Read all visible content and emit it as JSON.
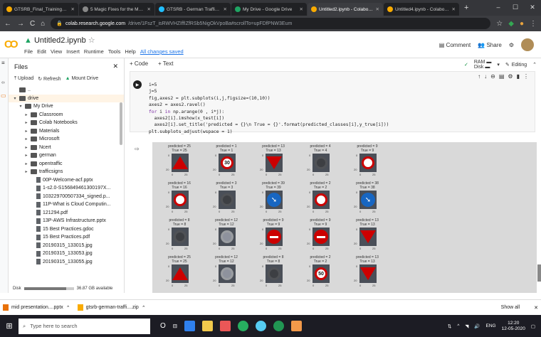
{
  "browser": {
    "tabs": [
      {
        "label": "GTSRB_Final_Training_Images",
        "color": "#f9ab00"
      },
      {
        "label": "5 Magic Fixes for the Most C",
        "color": "#888888"
      },
      {
        "label": "GTSRB - German Traffic Sign",
        "color": "#20beff"
      },
      {
        "label": "My Drive - Google Drive",
        "color": "#1fa463"
      },
      {
        "label": "Untitled2.ipynb - Colaborator",
        "color": "#f9ab00",
        "active": true
      },
      {
        "label": "Untitled4.ipynb - Colaborator",
        "color": "#f9ab00"
      }
    ],
    "url_host": "colab.research.google.com",
    "url_path": "/drive/1FszT_isRWVHZIffIZfRSb5NigOkVpoBa#scrollTo=upFDfPNW3Eum"
  },
  "colab": {
    "logo": "CO",
    "notebook_title": "Untitled2.ipynb",
    "menus": [
      "File",
      "Edit",
      "View",
      "Insert",
      "Runtime",
      "Tools",
      "Help"
    ],
    "saved_status": "All changes saved",
    "comment_label": "Comment",
    "share_label": "Share",
    "add_code": "+ Code",
    "add_text": "+ Text",
    "ram_label": "RAM",
    "disk_label": "Disk",
    "editing_label": "Editing"
  },
  "files_panel": {
    "title": "Files",
    "upload": "Upload",
    "refresh": "Refresh",
    "mount": "Mount Drive",
    "disk_text": "36.87 GB available",
    "disk_label": "Disk",
    "disk_used_fraction": 0.85,
    "items": [
      {
        "label": "..",
        "depth": 0,
        "kind": "folder"
      },
      {
        "label": "drive",
        "depth": 0,
        "kind": "folder",
        "caret": "▾"
      },
      {
        "label": "My Drive",
        "depth": 1,
        "kind": "folder",
        "caret": "▾"
      },
      {
        "label": "Classroom",
        "depth": 2,
        "kind": "folder",
        "caret": "▸"
      },
      {
        "label": "Colab Notebooks",
        "depth": 2,
        "kind": "folder",
        "caret": "▸"
      },
      {
        "label": "Materials",
        "depth": 2,
        "kind": "folder",
        "caret": "▸"
      },
      {
        "label": "Microsoft",
        "depth": 2,
        "kind": "folder",
        "caret": "▸"
      },
      {
        "label": "Ncert",
        "depth": 2,
        "kind": "folder",
        "caret": "▸"
      },
      {
        "label": "german",
        "depth": 2,
        "kind": "folder",
        "caret": "▸"
      },
      {
        "label": "opentraffic",
        "depth": 2,
        "kind": "folder",
        "caret": "▸"
      },
      {
        "label": "trafficsigns",
        "depth": 2,
        "kind": "folder",
        "caret": "▸"
      },
      {
        "label": "00P-Welcome-acf.pptx",
        "depth": 3,
        "kind": "file"
      },
      {
        "label": "1-s2.0-S156849461300197X...",
        "depth": 3,
        "kind": "file"
      },
      {
        "label": "103229700507334_signed.p...",
        "depth": 3,
        "kind": "file"
      },
      {
        "label": "11P-What is Cloud Computin...",
        "depth": 3,
        "kind": "file"
      },
      {
        "label": "121294.pdf",
        "depth": 3,
        "kind": "file"
      },
      {
        "label": "13P-AWS Infrastructure.pptx",
        "depth": 3,
        "kind": "file"
      },
      {
        "label": "15 Best Practices.gdoc",
        "depth": 3,
        "kind": "file"
      },
      {
        "label": "15 Best Practices.pdf",
        "depth": 3,
        "kind": "file"
      },
      {
        "label": "20190315_133015.jpg",
        "depth": 3,
        "kind": "file"
      },
      {
        "label": "20190315_133053.jpg",
        "depth": 3,
        "kind": "file"
      },
      {
        "label": "20190315_133055.jpg",
        "depth": 3,
        "kind": "file"
      }
    ]
  },
  "code_cell": {
    "lines": [
      "i=5",
      "j=5",
      "fig,axes2 = plt.subplots(i,j,figsize=(10,10))",
      "axes2 = axes2.ravel()",
      "for i in np.arange(0 , i*j):",
      "  axes2[i].imshow(x_test[i])",
      "  axes2[i].set_title('predicted = {}\\n True = {}'.format(predicted_classes[i],y_true[i]))",
      "plt.subplots_adjust(wspace = 1)"
    ]
  },
  "output_grid": [
    {
      "pred": "predicted = 25",
      "true": "True = 25",
      "sign": "tri"
    },
    {
      "pred": "predicted = 1",
      "true": "True = 1",
      "sign": "circ30"
    },
    {
      "pred": "predicted = 13",
      "true": "True = 13",
      "sign": "tridown"
    },
    {
      "pred": "predicted = 4",
      "true": "True = 4",
      "sign": "dark"
    },
    {
      "pred": "predicted = 9",
      "true": "True = 9",
      "sign": "circ"
    },
    {
      "pred": "predicted = 16",
      "true": "True = 16",
      "sign": "circ"
    },
    {
      "pred": "predicted = 3",
      "true": "True = 3",
      "sign": "dark"
    },
    {
      "pred": "predicted = 39",
      "true": "True = 39",
      "sign": "blue"
    },
    {
      "pred": "predicted = 2",
      "true": "True = 2",
      "sign": "circ"
    },
    {
      "pred": "predicted = 38",
      "true": "True = 38",
      "sign": "blue"
    },
    {
      "pred": "predicted = 8",
      "true": "True = 8",
      "sign": "dark"
    },
    {
      "pred": "predicted = 12",
      "true": "True = 12",
      "sign": "light"
    },
    {
      "pred": "predicted = 9",
      "true": "True = 9",
      "sign": "bar"
    },
    {
      "pred": "predicted = 9",
      "true": "True = 9",
      "sign": "bar"
    },
    {
      "pred": "predicted = 13",
      "true": "True = 13",
      "sign": "tridown"
    },
    {
      "pred": "predicted = 25",
      "true": "True = 25",
      "sign": "tri"
    },
    {
      "pred": "predicted = 12",
      "true": "True = 12",
      "sign": "light"
    },
    {
      "pred": "predicted = 8",
      "true": "True = 8",
      "sign": "dark"
    },
    {
      "pred": "predicted = 2",
      "true": "True = 2",
      "sign": "circ50"
    },
    {
      "pred": "predicted = 13",
      "true": "True = 13",
      "sign": "tridown"
    }
  ],
  "downloads": [
    {
      "label": "mid presentation....pptx"
    },
    {
      "label": "gtsrb-german-traffi....zip"
    }
  ],
  "show_all": "Show all",
  "taskbar": {
    "search_placeholder": "Type here to search",
    "time": "12:20",
    "date": "12-05-2020",
    "lang": "ENG"
  }
}
